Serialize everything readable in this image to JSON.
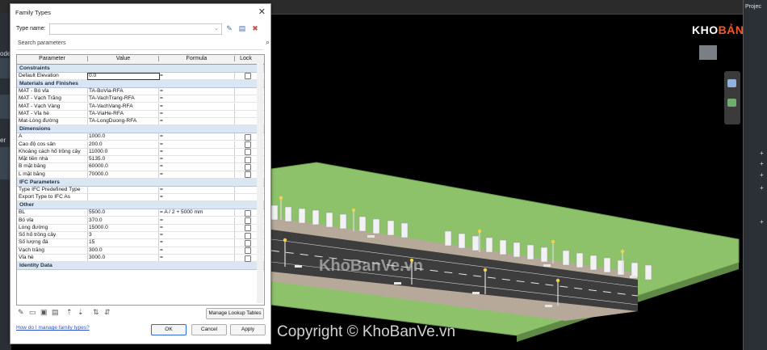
{
  "viewport": {
    "background": "#000000",
    "ground_color": "#8dc26b",
    "road_color": "#3d3d3d",
    "watermark_main": "Copyright © KhoBanVe.vn",
    "watermark_center": "KhoBanVe.vn",
    "right_panel_title": "Projec",
    "left_strip_tags": [
      "odels",
      "er"
    ]
  },
  "logo": {
    "text_main": "KHO",
    "text_accent": "BẢN VẼ",
    "accent_color": "#f15a24"
  },
  "dialog": {
    "title": "Family Types",
    "close_icon": "close-icon",
    "type_name_label": "Type name:",
    "type_name_value": "",
    "search_placeholder": "Search parameters",
    "columns": [
      "Parameter",
      "Value",
      "Formula",
      "Lock"
    ],
    "groups": [
      {
        "name": "Constraints",
        "rows": [
          {
            "param": "Default Elevation",
            "value": "0.0",
            "formula": "=",
            "lock": true,
            "editing": true
          }
        ]
      },
      {
        "name": "Materials and Finishes",
        "rows": [
          {
            "param": "MAT - Bó vỉa",
            "value": "TA-BoVia-RFA",
            "formula": "=",
            "lock": false
          },
          {
            "param": "MAT - Vạch Trắng",
            "value": "TA-VachTrang-RFA",
            "formula": "=",
            "lock": false
          },
          {
            "param": "MAT - Vạch Vàng",
            "value": "TA-VachVang-RFA",
            "formula": "=",
            "lock": false
          },
          {
            "param": "MAT - Vỉa hè",
            "value": "TA-ViaHe-RFA",
            "formula": "=",
            "lock": false
          },
          {
            "param": "Mat-Lòng đường",
            "value": "TA-LongDuong-RFA",
            "formula": "=",
            "lock": false
          }
        ]
      },
      {
        "name": "Dimensions",
        "rows": [
          {
            "param": "A",
            "value": "1000.0",
            "formula": "=",
            "lock": true
          },
          {
            "param": "Cao độ cos sân",
            "value": "200.0",
            "formula": "=",
            "lock": true
          },
          {
            "param": "Khoảng cách  hố trồng cây",
            "value": "11000.0",
            "formula": "=",
            "lock": true
          },
          {
            "param": "Mặt tiền nhà",
            "value": "5135.0",
            "formula": "=",
            "lock": true
          },
          {
            "param": "B mặt bằng",
            "value": "60000.0",
            "formula": "=",
            "lock": true
          },
          {
            "param": "L mặt bằng",
            "value": "70000.0",
            "formula": "=",
            "lock": true
          }
        ]
      },
      {
        "name": "IFC Parameters",
        "rows": [
          {
            "param": "Type IFC Predefined Type",
            "value": "",
            "formula": "=",
            "lock": false
          },
          {
            "param": "Export Type to IFC As",
            "value": "",
            "formula": "=",
            "lock": false
          }
        ]
      },
      {
        "name": "Other",
        "rows": [
          {
            "param": "BL",
            "value": "5500.0",
            "formula": "= A / 2 + 5000 mm",
            "lock": true
          },
          {
            "param": "Bó vỉa",
            "value": "370.0",
            "formula": "=",
            "lock": true
          },
          {
            "param": "Lòng đường",
            "value": "15000.0",
            "formula": "=",
            "lock": true
          },
          {
            "param": "Số hố trồng cây",
            "value": "3",
            "formula": "=",
            "lock": true
          },
          {
            "param": "Số lượng đá",
            "value": "15",
            "formula": "=",
            "lock": true
          },
          {
            "param": "Vạch trắng",
            "value": "300.0",
            "formula": "=",
            "lock": true
          },
          {
            "param": "Vỉa hè",
            "value": "3000.0",
            "formula": "=",
            "lock": true
          }
        ]
      },
      {
        "name": "Identity Data",
        "rows": []
      }
    ],
    "lookup_button": "Manage Lookup Tables",
    "help_link": "How do I manage family types?",
    "ok": "OK",
    "cancel": "Cancel",
    "apply": "Apply"
  }
}
